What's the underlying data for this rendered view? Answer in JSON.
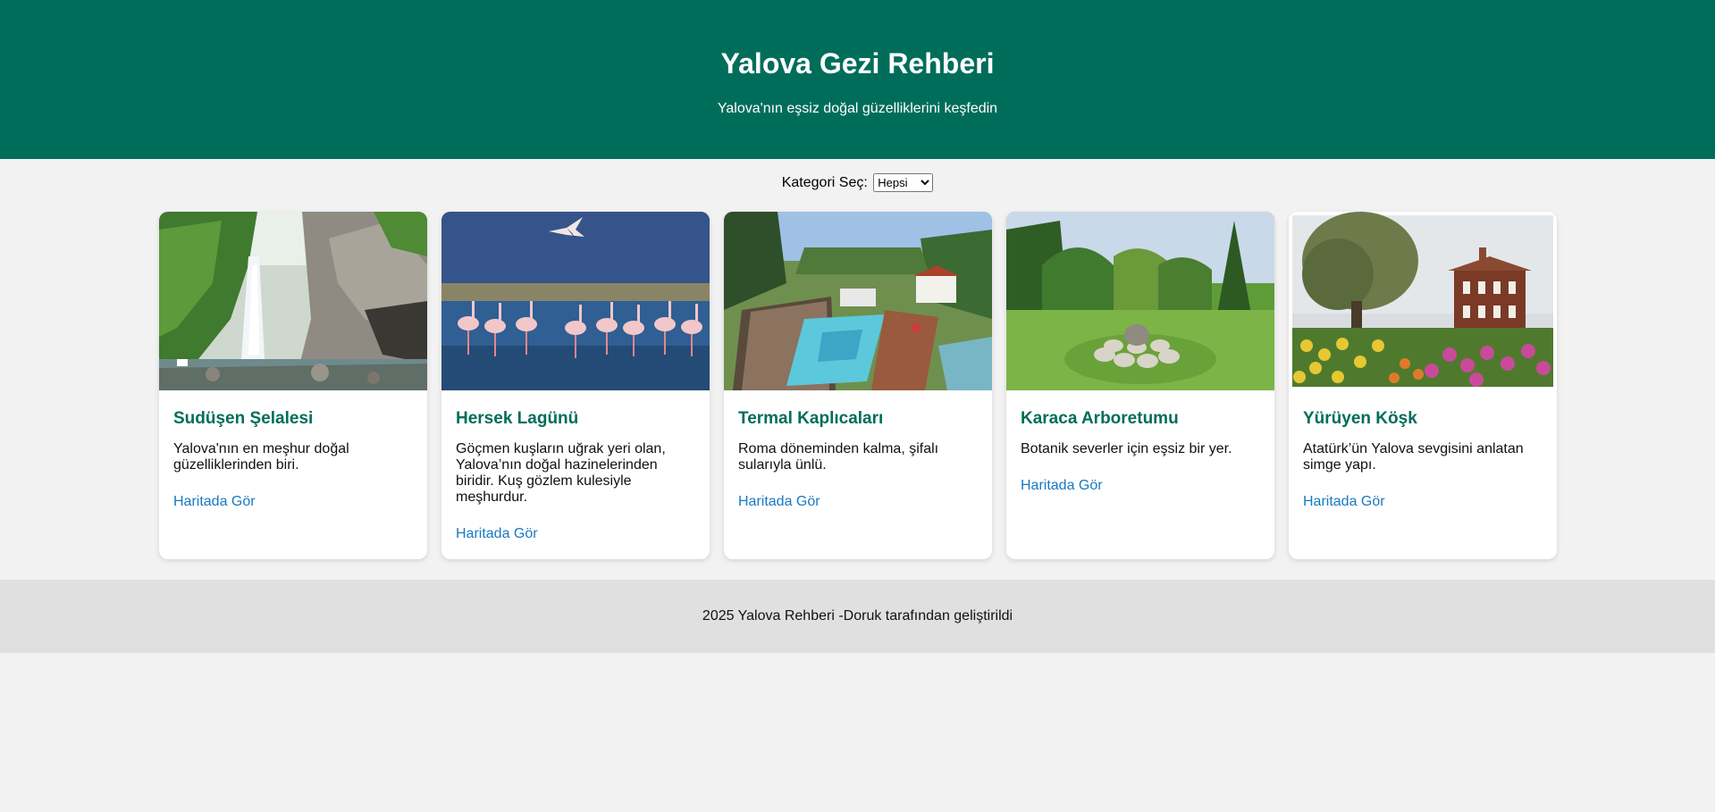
{
  "header": {
    "title": "Yalova Gezi Rehberi",
    "subtitle": "Yalova'nın eşsiz doğal güzelliklerini keşfedin"
  },
  "filter": {
    "label": "Kategori Seç:",
    "selected": "Hepsi"
  },
  "cards": [
    {
      "title": "Sudüşen Şelalesi",
      "description": "Yalova'nın en meşhur doğal güzelliklerinden biri.",
      "link": "Haritada Gör"
    },
    {
      "title": "Hersek Lagünü",
      "description": "Göçmen kuşların uğrak yeri olan, Yalova’nın doğal hazinelerinden biridir. Kuş gözlem kulesiyle meşhurdur.",
      "link": "Haritada Gör"
    },
    {
      "title": "Termal Kaplıcaları",
      "description": "Roma döneminden kalma, şifalı sularıyla ünlü.",
      "link": "Haritada Gör"
    },
    {
      "title": "Karaca Arboretumu",
      "description": "Botanik severler için eşsiz bir yer.",
      "link": "Haritada Gör"
    },
    {
      "title": "Yürüyen Köşk",
      "description": "Atatürk’ün Yalova sevgisini anlatan simge yapı.",
      "link": "Haritada Gör"
    }
  ],
  "footer": {
    "text": "2025 Yalova Rehberi -Doruk tarafından geliştirildi"
  },
  "colors": {
    "header_bg": "#006d5b",
    "title_green": "#006d5b",
    "link_blue": "#1779c2",
    "page_bg": "#f2f2f2",
    "footer_bg": "#e0e0e0"
  }
}
